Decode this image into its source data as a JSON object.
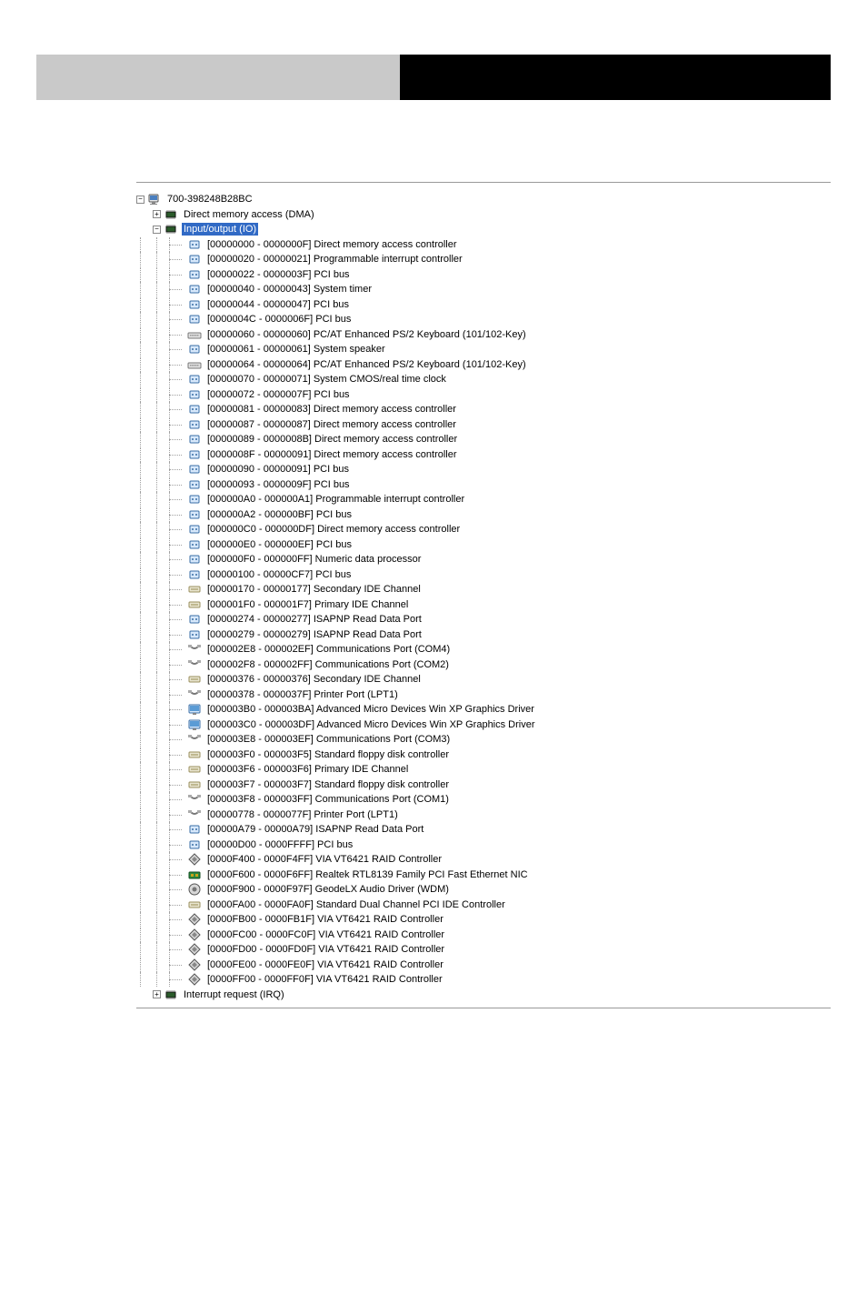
{
  "root": {
    "name": "700-398248B28BC",
    "children": [
      {
        "label": "Direct memory access (DMA)",
        "expanded": false,
        "icon": "chip"
      },
      {
        "label": "Input/output (IO)",
        "expanded": true,
        "selected": true,
        "icon": "chip",
        "items": [
          {
            "icon": "port",
            "text": "[00000000 - 0000000F]  Direct memory access controller"
          },
          {
            "icon": "port",
            "text": "[00000020 - 00000021]  Programmable interrupt controller"
          },
          {
            "icon": "port",
            "text": "[00000022 - 0000003F]  PCI bus"
          },
          {
            "icon": "port",
            "text": "[00000040 - 00000043]  System timer"
          },
          {
            "icon": "port",
            "text": "[00000044 - 00000047]  PCI bus"
          },
          {
            "icon": "port",
            "text": "[0000004C - 0000006F]  PCI bus"
          },
          {
            "icon": "keyboard",
            "text": "[00000060 - 00000060]  PC/AT Enhanced PS/2 Keyboard (101/102-Key)"
          },
          {
            "icon": "port",
            "text": "[00000061 - 00000061]  System speaker"
          },
          {
            "icon": "keyboard",
            "text": "[00000064 - 00000064]  PC/AT Enhanced PS/2 Keyboard (101/102-Key)"
          },
          {
            "icon": "port",
            "text": "[00000070 - 00000071]  System CMOS/real time clock"
          },
          {
            "icon": "port",
            "text": "[00000072 - 0000007F]  PCI bus"
          },
          {
            "icon": "port",
            "text": "[00000081 - 00000083]  Direct memory access controller"
          },
          {
            "icon": "port",
            "text": "[00000087 - 00000087]  Direct memory access controller"
          },
          {
            "icon": "port",
            "text": "[00000089 - 0000008B]  Direct memory access controller"
          },
          {
            "icon": "port",
            "text": "[0000008F - 00000091]  Direct memory access controller"
          },
          {
            "icon": "port",
            "text": "[00000090 - 00000091]  PCI bus"
          },
          {
            "icon": "port",
            "text": "[00000093 - 0000009F]  PCI bus"
          },
          {
            "icon": "port",
            "text": "[000000A0 - 000000A1]  Programmable interrupt controller"
          },
          {
            "icon": "port",
            "text": "[000000A2 - 000000BF]  PCI bus"
          },
          {
            "icon": "port",
            "text": "[000000C0 - 000000DF]  Direct memory access controller"
          },
          {
            "icon": "port",
            "text": "[000000E0 - 000000EF]  PCI bus"
          },
          {
            "icon": "port",
            "text": "[000000F0 - 000000FF]  Numeric data processor"
          },
          {
            "icon": "port",
            "text": "[00000100 - 00000CF7]  PCI bus"
          },
          {
            "icon": "ide",
            "text": "[00000170 - 00000177]  Secondary IDE Channel"
          },
          {
            "icon": "ide",
            "text": "[000001F0 - 000001F7]  Primary IDE Channel"
          },
          {
            "icon": "port",
            "text": "[00000274 - 00000277]  ISAPNP Read Data Port"
          },
          {
            "icon": "port",
            "text": "[00000279 - 00000279]  ISAPNP Read Data Port"
          },
          {
            "icon": "com",
            "text": "[000002E8 - 000002EF]  Communications Port (COM4)"
          },
          {
            "icon": "com",
            "text": "[000002F8 - 000002FF]  Communications Port (COM2)"
          },
          {
            "icon": "ide",
            "text": "[00000376 - 00000376]  Secondary IDE Channel"
          },
          {
            "icon": "com",
            "text": "[00000378 - 0000037F]  Printer Port (LPT1)"
          },
          {
            "icon": "display",
            "text": "[000003B0 - 000003BA]  Advanced Micro Devices Win XP Graphics Driver"
          },
          {
            "icon": "display",
            "text": "[000003C0 - 000003DF]  Advanced Micro Devices Win XP Graphics Driver"
          },
          {
            "icon": "com",
            "text": "[000003E8 - 000003EF]  Communications Port (COM3)"
          },
          {
            "icon": "ide",
            "text": "[000003F0 - 000003F5]  Standard floppy disk controller"
          },
          {
            "icon": "ide",
            "text": "[000003F6 - 000003F6]  Primary IDE Channel"
          },
          {
            "icon": "ide",
            "text": "[000003F7 - 000003F7]  Standard floppy disk controller"
          },
          {
            "icon": "com",
            "text": "[000003F8 - 000003FF]  Communications Port (COM1)"
          },
          {
            "icon": "com",
            "text": "[00000778 - 0000077F]  Printer Port (LPT1)"
          },
          {
            "icon": "port",
            "text": "[00000A79 - 00000A79]  ISAPNP Read Data Port"
          },
          {
            "icon": "port",
            "text": "[00000D00 - 0000FFFF]  PCI bus"
          },
          {
            "icon": "raid",
            "text": "[0000F400 - 0000F4FF]  VIA VT6421 RAID Controller"
          },
          {
            "icon": "nic",
            "text": "[0000F600 - 0000F6FF]  Realtek RTL8139 Family PCI Fast Ethernet NIC"
          },
          {
            "icon": "audio",
            "text": "[0000F900 - 0000F97F]  GeodeLX Audio Driver (WDM)"
          },
          {
            "icon": "ide",
            "text": "[0000FA00 - 0000FA0F]  Standard Dual Channel PCI IDE Controller"
          },
          {
            "icon": "raid",
            "text": "[0000FB00 - 0000FB1F]  VIA VT6421 RAID Controller"
          },
          {
            "icon": "raid",
            "text": "[0000FC00 - 0000FC0F]  VIA VT6421 RAID Controller"
          },
          {
            "icon": "raid",
            "text": "[0000FD00 - 0000FD0F]  VIA VT6421 RAID Controller"
          },
          {
            "icon": "raid",
            "text": "[0000FE00 - 0000FE0F]  VIA VT6421 RAID Controller"
          },
          {
            "icon": "raid",
            "text": "[0000FF00 - 0000FF0F]  VIA VT6421 RAID Controller"
          }
        ]
      },
      {
        "label": "Interrupt request (IRQ)",
        "expanded": false,
        "icon": "chip"
      }
    ]
  }
}
